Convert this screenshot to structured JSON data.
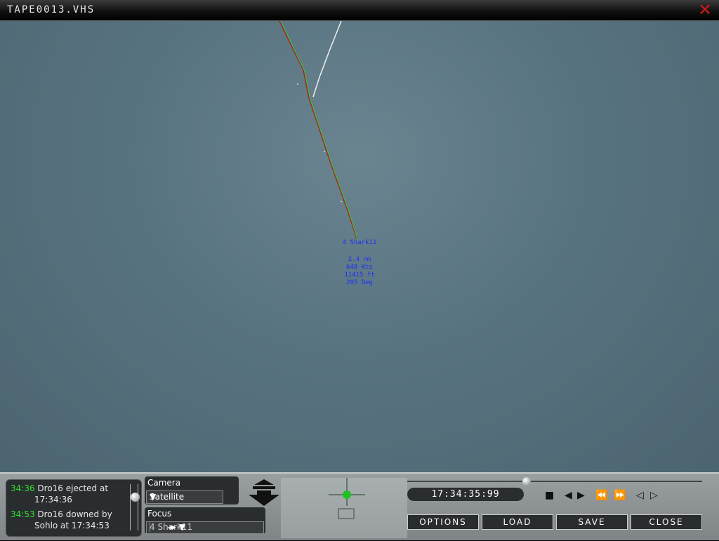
{
  "window": {
    "title": "TAPE0013.VHS",
    "close_icon": "close-icon",
    "close_color": "#d01818"
  },
  "viewport": {
    "label": {
      "name": "4 Shark11",
      "range": "2.4 nm",
      "speed": "648 Kts",
      "altitude": "11415 ft",
      "heading": "205 Deg"
    },
    "label_color": "#1a2cff"
  },
  "events": [
    {
      "time": "34:36",
      "line1": "Dro16 ejected at",
      "line2": "17:34:36"
    },
    {
      "time": "34:53",
      "line1": "Dro16 downed by",
      "line2": "Sohlo at 17:34:53"
    }
  ],
  "camera": {
    "label": "Camera",
    "value": "Satellite"
  },
  "focus": {
    "label": "Focus",
    "value": "4 Shark11"
  },
  "playback": {
    "time": "17:34:35:99"
  },
  "buttons": {
    "options": "Options",
    "load": "Load",
    "save": "Save",
    "close": "Close"
  }
}
